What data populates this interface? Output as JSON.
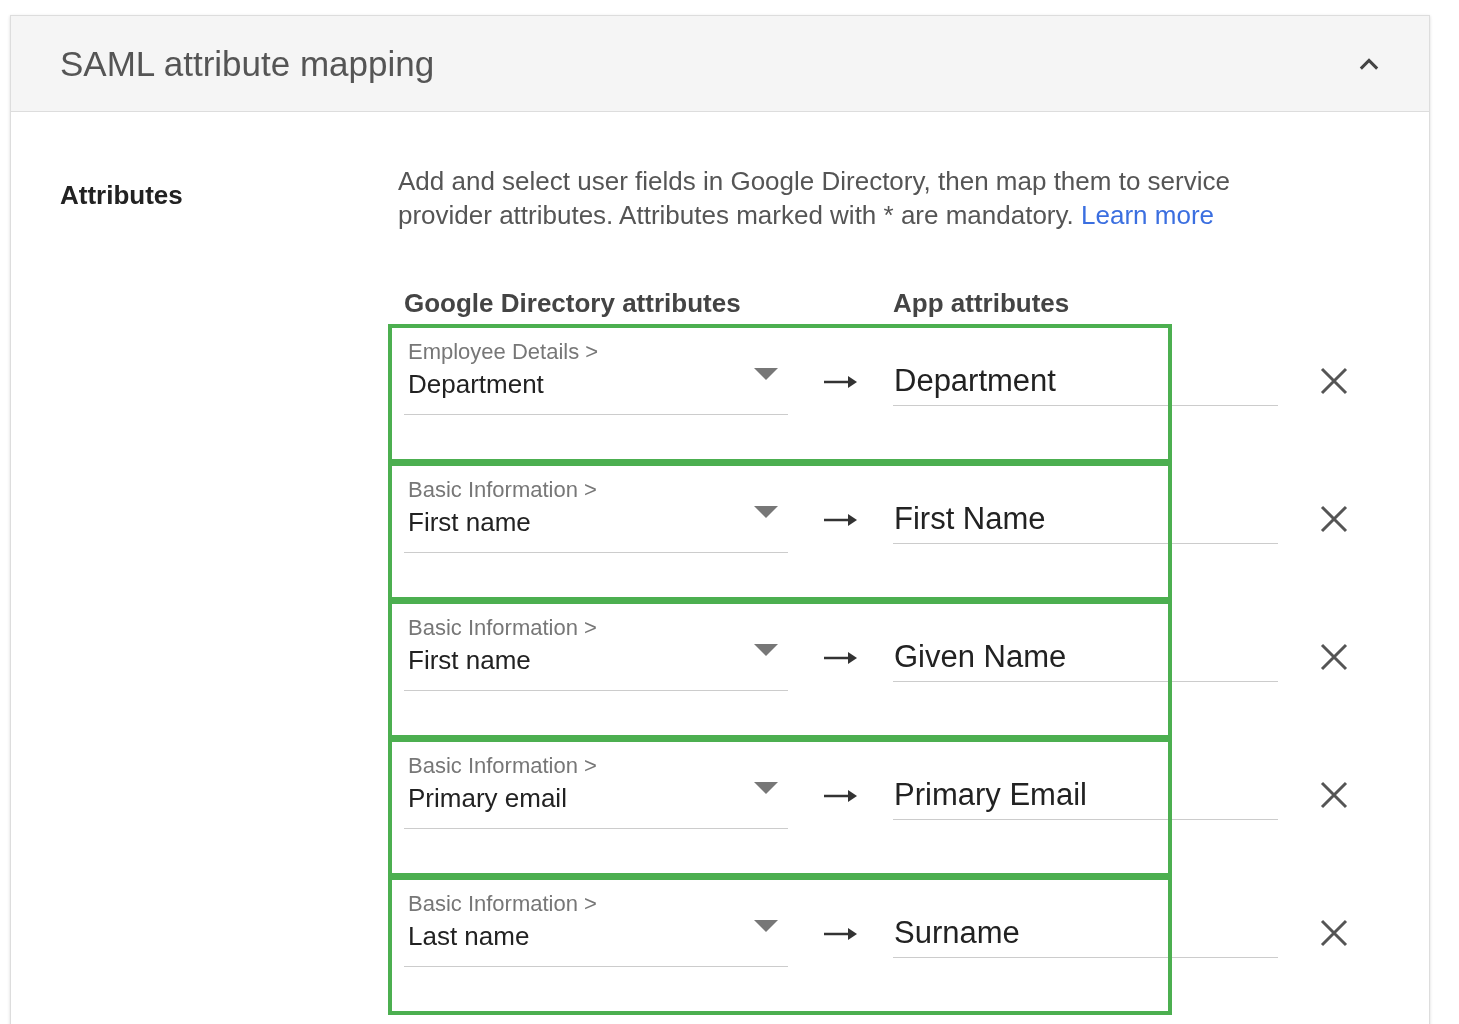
{
  "panel": {
    "title": "SAML attribute mapping",
    "expanded": true
  },
  "section_label": "Attributes",
  "description": {
    "text": "Add and select user fields in Google Directory, then map them to service provider attributes. Attributes marked with * are mandatory.",
    "link": "Learn more"
  },
  "columns": [
    "Google Directory attributes",
    "App attributes"
  ],
  "rows": [
    {
      "category": "Employee Details >",
      "field": "Department",
      "app_attribute": "Department",
      "highlighted": true
    },
    {
      "category": "Basic Information >",
      "field": "First name",
      "app_attribute": "First Name",
      "highlighted": true
    },
    {
      "category": "Basic Information >",
      "field": "First name",
      "app_attribute": "Given Name",
      "highlighted": true
    },
    {
      "category": "Basic Information >",
      "field": "Primary email",
      "app_attribute": "Primary Email",
      "highlighted": true
    },
    {
      "category": "Basic Information >",
      "field": "Last name",
      "app_attribute": "Surname",
      "highlighted": true
    }
  ]
}
